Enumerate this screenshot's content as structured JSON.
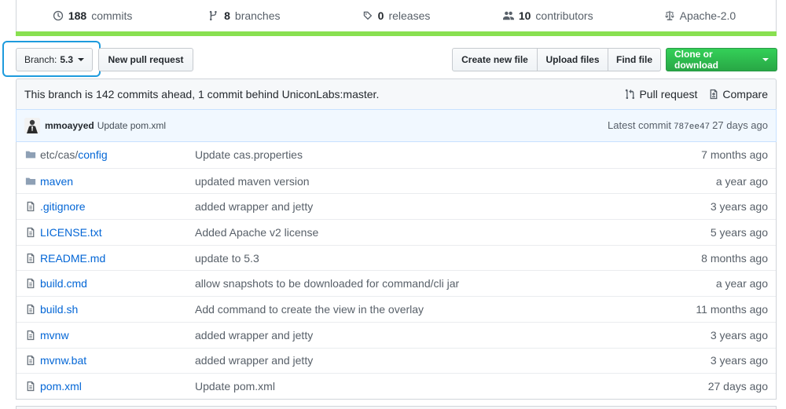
{
  "stats": {
    "commits": {
      "count": "188",
      "label": "commits",
      "icon": "history-icon"
    },
    "branches": {
      "count": "8",
      "label": "branches",
      "icon": "branch-icon"
    },
    "releases": {
      "count": "0",
      "label": "releases",
      "icon": "tag-icon"
    },
    "contributors": {
      "count": "10",
      "label": "contributors",
      "icon": "people-icon"
    },
    "license": {
      "label": "Apache-2.0",
      "icon": "law-icon"
    }
  },
  "language_color": "#89e051",
  "toolbar": {
    "branch_prefix": "Branch:",
    "branch_name": "5.3",
    "new_pull_request": "New pull request",
    "create_new_file": "Create new file",
    "upload_files": "Upload files",
    "find_file": "Find file",
    "clone_or_download": "Clone or download"
  },
  "compare": {
    "message": "This branch is 142 commits ahead, 1 commit behind UniconLabs:master.",
    "pull_request": "Pull request",
    "compare": "Compare"
  },
  "latest_commit": {
    "author": "mmoayyed",
    "message": "Update pom.xml",
    "prefix": "Latest commit",
    "sha": "787ee47",
    "age": "27 days ago"
  },
  "files": [
    {
      "type": "dir",
      "name_prefix": "etc/cas/",
      "name": "config",
      "message": "Update cas.properties",
      "age": "7 months ago"
    },
    {
      "type": "dir",
      "name_prefix": "",
      "name": "maven",
      "message": "updated maven version",
      "age": "a year ago"
    },
    {
      "type": "file",
      "name_prefix": "",
      "name": ".gitignore",
      "message": "added wrapper and jetty",
      "age": "3 years ago"
    },
    {
      "type": "file",
      "name_prefix": "",
      "name": "LICENSE.txt",
      "message": "Added Apache v2 license",
      "age": "5 years ago"
    },
    {
      "type": "file",
      "name_prefix": "",
      "name": "README.md",
      "message": "update to 5.3",
      "age": "8 months ago"
    },
    {
      "type": "file",
      "name_prefix": "",
      "name": "build.cmd",
      "message": "allow snapshots to be downloaded for command/cli jar",
      "age": "a year ago"
    },
    {
      "type": "file",
      "name_prefix": "",
      "name": "build.sh",
      "message": "Add command to create the view in the overlay",
      "age": "11 months ago"
    },
    {
      "type": "file",
      "name_prefix": "",
      "name": "mvnw",
      "message": "added wrapper and jetty",
      "age": "3 years ago"
    },
    {
      "type": "file",
      "name_prefix": "",
      "name": "mvnw.bat",
      "message": "added wrapper and jetty",
      "age": "3 years ago"
    },
    {
      "type": "file",
      "name_prefix": "",
      "name": "pom.xml",
      "message": "Update pom.xml",
      "age": "27 days ago"
    }
  ]
}
